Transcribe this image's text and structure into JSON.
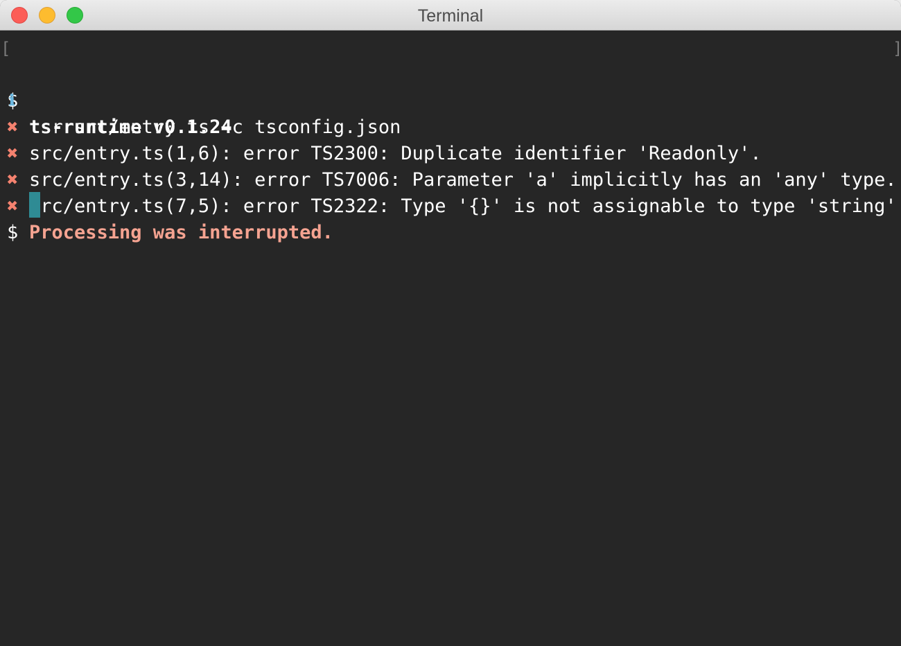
{
  "window": {
    "title": "Terminal"
  },
  "terminal": {
    "command": {
      "prompt": "$",
      "text": "tsr src/entry.ts −c tsconfig.json"
    },
    "version": {
      "icon": "info-icon",
      "symbol": "ℹ",
      "text": "ts-runtime v0.1.24"
    },
    "errors": [
      {
        "icon": "error-icon",
        "symbol": "✖",
        "text": "src/entry.ts(1,6): error TS2300: Duplicate identifier 'Readonly'."
      },
      {
        "icon": "error-icon",
        "symbol": "✖",
        "text": "src/entry.ts(3,14): error TS7006: Parameter 'a' implicitly has an 'any' type."
      },
      {
        "icon": "error-icon",
        "symbol": "✖",
        "text": "src/entry.ts(7,5): error TS2322: Type '{}' is not assignable to type 'string'."
      }
    ],
    "interrupted": {
      "icon": "error-icon",
      "symbol": "✖",
      "text": "Processing was interrupted."
    },
    "prompt": {
      "symbol": "$"
    },
    "brackets": {
      "left": "[",
      "right": "]"
    }
  },
  "colors": {
    "background": "#262626",
    "foreground": "#ffffff",
    "info": "#6cb8e0",
    "error": "#f4826f",
    "interrupted": "#f5a391",
    "cursor": "#2f8b94"
  }
}
